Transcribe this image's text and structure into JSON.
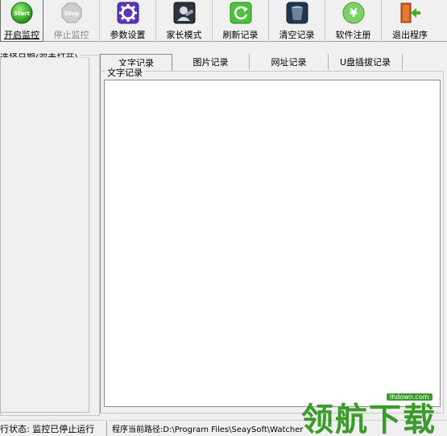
{
  "toolbar": {
    "buttons": [
      {
        "label": "开启监控",
        "icon": "start-icon",
        "enabled": true
      },
      {
        "label": "停止监控",
        "icon": "stop-icon",
        "enabled": false
      },
      {
        "label": "参数设置",
        "icon": "settings-icon",
        "enabled": true
      },
      {
        "label": "家长模式",
        "icon": "parent-mode-icon",
        "enabled": true
      },
      {
        "label": "刷新记录",
        "icon": "refresh-icon",
        "enabled": true
      },
      {
        "label": "清空记录",
        "icon": "trash-icon",
        "enabled": true
      },
      {
        "label": "软件注册",
        "icon": "register-icon",
        "enabled": true
      },
      {
        "label": "退出程序",
        "icon": "exit-icon",
        "enabled": true
      }
    ],
    "start_icon_text": "Start",
    "stop_icon_text": "Stop"
  },
  "left_panel": {
    "legend": "选择日期(双击打开)"
  },
  "tabs": [
    {
      "label": "文字记录",
      "active": true
    },
    {
      "label": "图片记录",
      "active": false
    },
    {
      "label": "网址记录",
      "active": false
    },
    {
      "label": "U盘插拔记录",
      "active": false
    }
  ],
  "content": {
    "legend": "文字记录",
    "text": ""
  },
  "statusbar": {
    "status": "行状态: 监控已停止运行",
    "path": "程序当前路径:D:\\Program Files\\SeaySoft\\Watcher"
  },
  "watermark": {
    "text": "领航下载",
    "url": "lhdown.com"
  },
  "colors": {
    "background": "#f0f0f0",
    "watermark_green": "#3a9c2a"
  }
}
